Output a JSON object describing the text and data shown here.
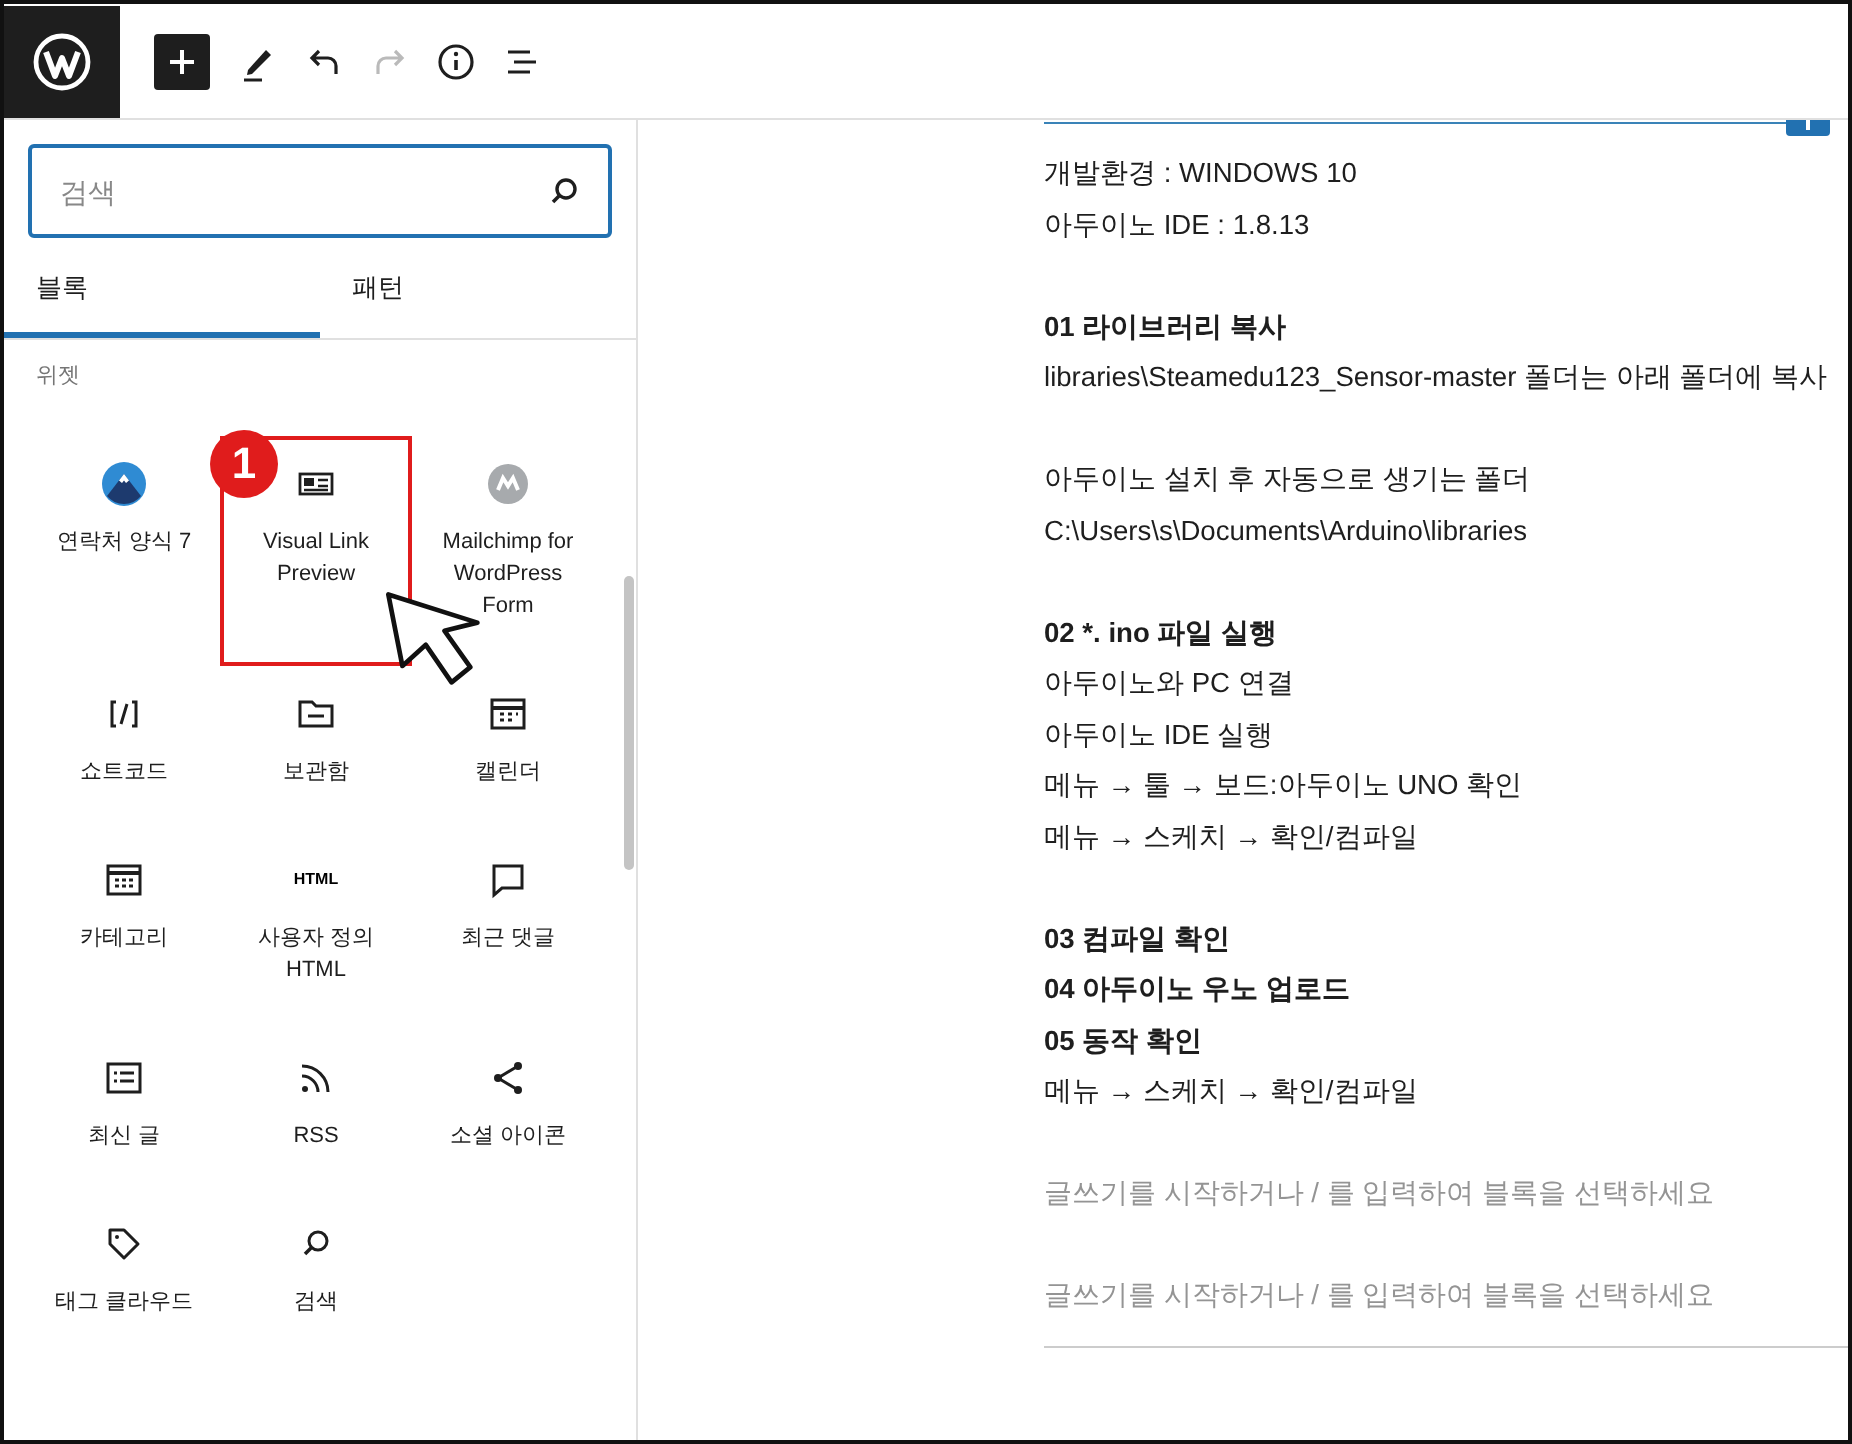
{
  "toolbar": [
    {
      "kind": "logo",
      "disabled": false
    },
    {
      "kind": "add",
      "disabled": false
    },
    {
      "kind": "edit",
      "disabled": false
    },
    {
      "kind": "undo",
      "disabled": false
    },
    {
      "kind": "redo",
      "disabled": true
    },
    {
      "kind": "info",
      "disabled": false
    },
    {
      "kind": "outline",
      "disabled": false
    }
  ],
  "inserter": {
    "search": {
      "placeholder": "검색"
    },
    "tabs": [
      {
        "label": "블록",
        "selected": true
      },
      {
        "label": "패턴",
        "selected": false
      }
    ],
    "section_label": "위젯",
    "blocks": [
      {
        "label": "연락처 양식 7",
        "highlighted": false
      },
      {
        "label": "Visual Link Preview",
        "highlighted": true
      },
      {
        "label": "Mailchimp for WordPress Form",
        "highlighted": false
      },
      {
        "label": "쇼트코드",
        "highlighted": false
      },
      {
        "label": "보관함",
        "highlighted": false
      },
      {
        "label": "캘린더",
        "highlighted": false
      },
      {
        "label": "카테고리",
        "highlighted": false
      },
      {
        "label": "사용자 정의 HTML",
        "icon_text": "HTML",
        "highlighted": false
      },
      {
        "label": "최근 댓글",
        "highlighted": false
      },
      {
        "label": "최신 글",
        "highlighted": false
      },
      {
        "label": "RSS",
        "highlighted": false
      },
      {
        "label": "소셜 아이콘",
        "highlighted": false
      },
      {
        "label": "태그 클라우드",
        "highlighted": false
      },
      {
        "label": "검색",
        "highlighted": false
      }
    ]
  },
  "annotation": {
    "number": "1"
  },
  "editor": [
    {
      "kind": "text",
      "text": "개발환경 : WINDOWS 10"
    },
    {
      "kind": "text",
      "text": "아두이노 IDE : 1.8.13"
    },
    {
      "kind": "blank"
    },
    {
      "kind": "heading",
      "text": "01 라이브러리 복사"
    },
    {
      "kind": "text",
      "text": "libraries\\Steamedu123_Sensor-master 폴더는 아래 폴더에 복사"
    },
    {
      "kind": "blank"
    },
    {
      "kind": "text",
      "text": "아두이노 설치 후 자동으로 생기는 폴더"
    },
    {
      "kind": "text",
      "text": "C:\\Users\\s\\Documents\\Arduino\\libraries"
    },
    {
      "kind": "blank"
    },
    {
      "kind": "heading",
      "text": "02 *. ino 파일 실행"
    },
    {
      "kind": "text",
      "text": "아두이노와 PC 연결"
    },
    {
      "kind": "text",
      "text": "아두이노 IDE 실행"
    },
    {
      "kind": "text",
      "text": "메뉴 → 툴 → 보드:아두이노 UNO 확인"
    },
    {
      "kind": "text",
      "text": "메뉴 → 스케치 → 확인/컴파일"
    },
    {
      "kind": "blank"
    },
    {
      "kind": "heading",
      "text": "03 컴파일 확인"
    },
    {
      "kind": "heading",
      "text": "04 아두이노 우노 업로드"
    },
    {
      "kind": "heading",
      "text": "05 동작 확인"
    },
    {
      "kind": "text",
      "text": "메뉴 → 스케치 → 확인/컴파일"
    },
    {
      "kind": "blank"
    },
    {
      "kind": "placeholder",
      "text": "글쓰기를 시작하거나 / 를 입력하여 블록을 선택하세요"
    },
    {
      "kind": "blank"
    },
    {
      "kind": "placeholder",
      "text": "글쓰기를 시작하거나 / 를 입력하여 블록을 선택하세요"
    },
    {
      "kind": "separator"
    }
  ]
}
